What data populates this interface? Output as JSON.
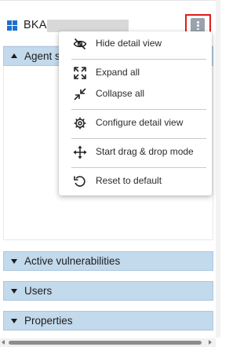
{
  "header": {
    "host_name": "BKA-",
    "os_icon": "windows-logo-icon",
    "menu_icon": "kebab-menu-icon"
  },
  "sections": {
    "agent_status": "Agent s",
    "active_vulnerabilities": "Active vulnerabilities",
    "users": "Users",
    "properties": "Properties"
  },
  "context_menu": {
    "hide_detail_view": "Hide detail view",
    "expand_all": "Expand all",
    "collapse_all": "Collapse all",
    "configure_detail_view": "Configure detail view",
    "start_drag_drop": "Start drag & drop mode",
    "reset_to_default": "Reset to default"
  },
  "colors": {
    "section_bar": "#c3d9ec",
    "highlight_border": "#e11c1c",
    "windows_blue": "#1f6fd0"
  }
}
